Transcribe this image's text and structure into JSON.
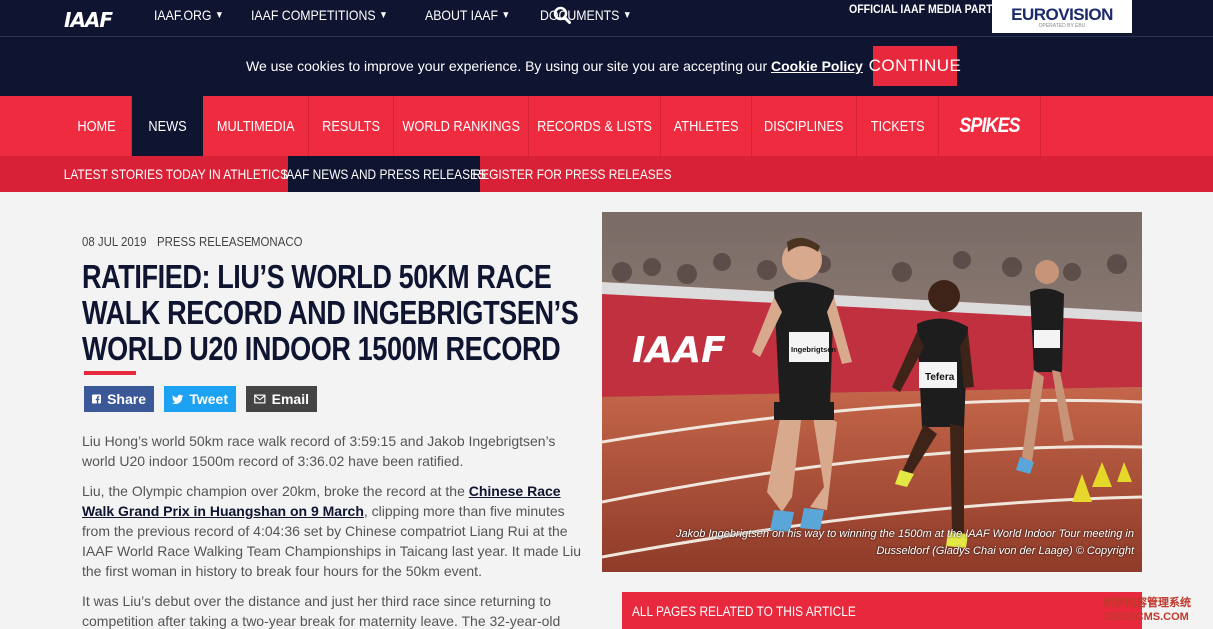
{
  "header": {
    "logo": "IAAF",
    "top_links": [
      {
        "label": "IAAF.ORG"
      },
      {
        "label": "IAAF COMPETITIONS"
      },
      {
        "label": "ABOUT IAAF"
      },
      {
        "label": "DOCUMENTS"
      }
    ],
    "partner_label": "OFFICIAL IAAF MEDIA PARTNER",
    "partner_name": "EUROVISION",
    "partner_sub": "OPERATED BY EBU"
  },
  "cookie": {
    "text": "We use cookies to improve your experience. By using our site you are accepting our ",
    "link": "Cookie Policy",
    "button": "CONTINUE"
  },
  "main_nav": [
    {
      "label": "HOME"
    },
    {
      "label": "NEWS",
      "active": true
    },
    {
      "label": "MULTIMEDIA"
    },
    {
      "label": "RESULTS"
    },
    {
      "label": "WORLD RANKINGS"
    },
    {
      "label": "RECORDS & LISTS"
    },
    {
      "label": "ATHLETES"
    },
    {
      "label": "DISCIPLINES"
    },
    {
      "label": "TICKETS"
    },
    {
      "label": "SPIKES"
    }
  ],
  "sub_nav": [
    {
      "label": "LATEST STORIES"
    },
    {
      "label": "TODAY IN ATHLETICS"
    },
    {
      "label": "IAAF NEWS AND PRESS RELEASES",
      "active": true
    },
    {
      "label": "REGISTER FOR PRESS RELEASES"
    }
  ],
  "article": {
    "date": "08 JUL 2019",
    "category": "PRESS RELEASE",
    "location": "MONACO",
    "headline_lines": [
      "RATIFIED: LIU’S WORLD 50KM RACE",
      "WALK RECORD AND INGEBRIGTSEN’S",
      "WORLD U20 INDOOR 1500M RECORD"
    ],
    "share": {
      "facebook": "Share",
      "twitter": "Tweet",
      "email": "Email"
    },
    "p1": "Liu Hong’s world 50km race walk record of 3:59:15 and Jakob Ingebrigtsen’s world U20 indoor 1500m record of 3:36.02 have been ratified.",
    "p2_pre": "Liu, the Olympic champion over 20km, broke the record at the ",
    "p2_link": "Chinese Race Walk Grand Prix in Huangshan on 9 March",
    "p2_post": ", clipping more than five minutes from the previous record of 4:04:36 set by Chinese compatriot Liang Rui at the IAAF World Race Walking Team Championships in Taicang last year. It made Liu the first woman in history to break four hours for the 50km event.",
    "p3": "It was Liu’s debut over the distance and just her third race since returning to competition after taking a two-year break for maternity leave. The 32-year-old",
    "photo_caption": "Jakob Ingebrigtsen on his way to winning the 1500m at the IAAF World Indoor Tour meeting in Dusseldorf (Gladys Chai von der Laage) © Copyright",
    "bib1": "Ingebrigtsen J.",
    "bib2": "Tefera",
    "banner_text": "IAAF"
  },
  "related": {
    "title": "ALL PAGES RELATED TO THIS ARTICLE"
  },
  "watermark": {
    "line1": "织梦内容管理系统",
    "line2": "DEDECMS.COM"
  }
}
